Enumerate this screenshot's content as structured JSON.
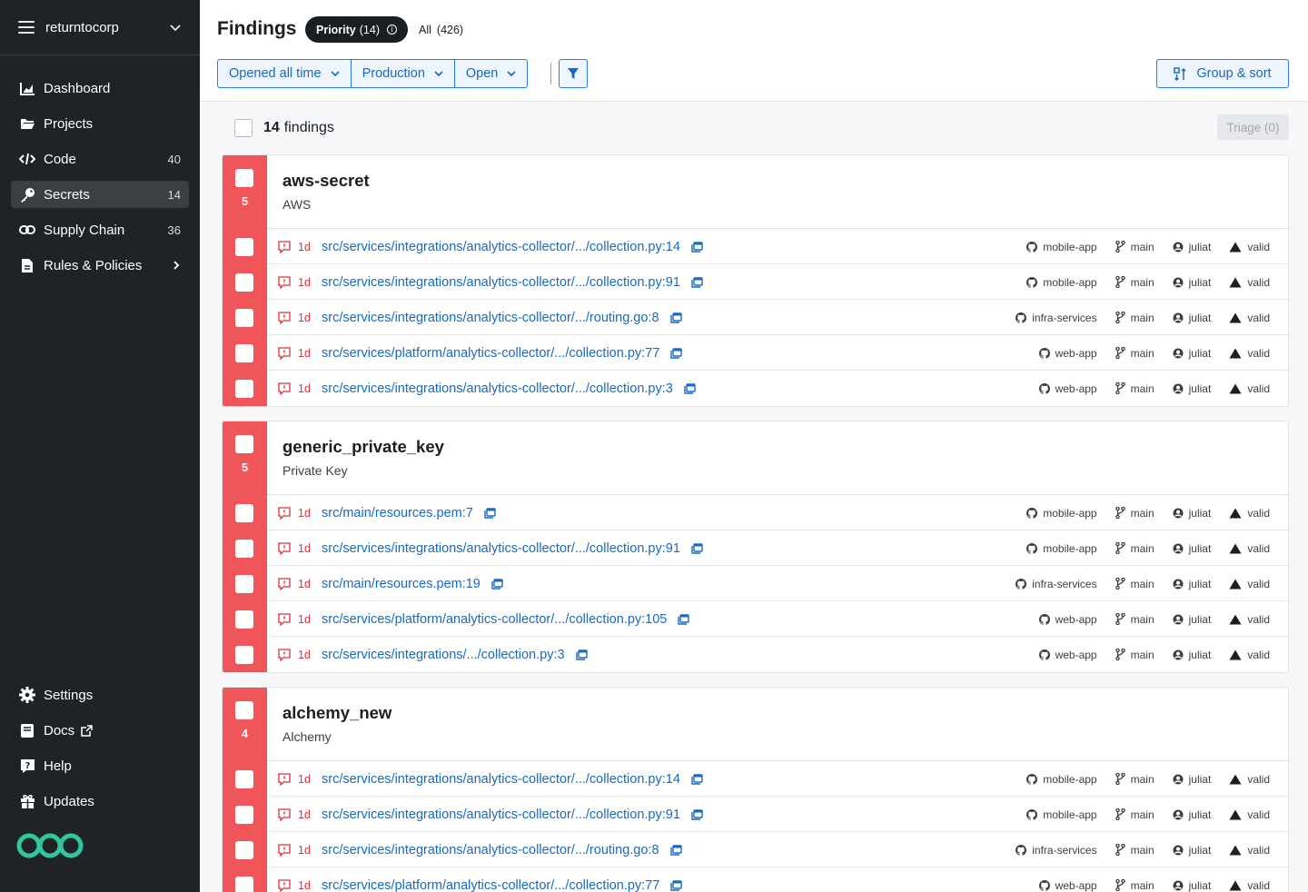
{
  "sidebar": {
    "org": "returntocorp",
    "items": [
      {
        "label": "Dashboard",
        "count": "",
        "icon": "chart-icon"
      },
      {
        "label": "Projects",
        "count": "",
        "icon": "folder-icon"
      },
      {
        "label": "Code",
        "count": "40",
        "icon": "code-icon"
      },
      {
        "label": "Secrets",
        "count": "14",
        "icon": "key-icon"
      },
      {
        "label": "Supply Chain",
        "count": "36",
        "icon": "link-icon"
      },
      {
        "label": "Rules & Policies",
        "count": "",
        "icon": "rules-icon"
      }
    ],
    "bottom": [
      {
        "label": "Settings"
      },
      {
        "label": "Docs"
      },
      {
        "label": "Help"
      },
      {
        "label": "Updates"
      }
    ]
  },
  "header": {
    "title": "Findings",
    "priority_label": "Priority",
    "priority_count": "(14)",
    "all_label": "All",
    "all_count": "(426)",
    "filters": [
      "Opened all time",
      "Production",
      "Open"
    ],
    "group_sort": "Group & sort"
  },
  "toolbar": {
    "count": "14",
    "count_label": "findings",
    "triage": "Triage (0)"
  },
  "colors": {
    "accent": "#2c7be5",
    "critical": "#f0555a",
    "sidebar": "#1f2326"
  },
  "groups": [
    {
      "name": "aws-secret",
      "sub": "AWS",
      "count": "5",
      "rows": [
        {
          "age": "1d",
          "path": "src/services/integrations/analytics-collector/.../collection.py:14",
          "repo": "mobile-app",
          "branch": "main",
          "user": "juliat",
          "status": "valid"
        },
        {
          "age": "1d",
          "path": "src/services/integrations/analytics-collector/.../collection.py:91",
          "repo": "mobile-app",
          "branch": "main",
          "user": "juliat",
          "status": "valid"
        },
        {
          "age": "1d",
          "path": "src/services/integrations/analytics-collector/.../routing.go:8",
          "repo": "infra-services",
          "branch": "main",
          "user": "juliat",
          "status": "valid"
        },
        {
          "age": "1d",
          "path": "src/services/platform/analytics-collector/.../collection.py:77",
          "repo": "web-app",
          "branch": "main",
          "user": "juliat",
          "status": "valid"
        },
        {
          "age": "1d",
          "path": "src/services/integrations/analytics-collector/.../collection.py:3",
          "repo": "web-app",
          "branch": "main",
          "user": "juliat",
          "status": "valid"
        }
      ]
    },
    {
      "name": "generic_private_key",
      "sub": "Private Key",
      "count": "5",
      "rows": [
        {
          "age": "1d",
          "path": "src/main/resources.pem:7",
          "repo": "mobile-app",
          "branch": "main",
          "user": "juliat",
          "status": "valid"
        },
        {
          "age": "1d",
          "path": "src/services/integrations/analytics-collector/.../collection.py:91",
          "repo": "mobile-app",
          "branch": "main",
          "user": "juliat",
          "status": "valid"
        },
        {
          "age": "1d",
          "path": "src/main/resources.pem:19",
          "repo": "infra-services",
          "branch": "main",
          "user": "juliat",
          "status": "valid"
        },
        {
          "age": "1d",
          "path": "src/services/platform/analytics-collector/.../collection.py:105",
          "repo": "web-app",
          "branch": "main",
          "user": "juliat",
          "status": "valid"
        },
        {
          "age": "1d",
          "path": "src/services/integrations/.../collection.py:3",
          "repo": "web-app",
          "branch": "main",
          "user": "juliat",
          "status": "valid"
        }
      ]
    },
    {
      "name": "alchemy_new",
      "sub": "Alchemy",
      "count": "4",
      "rows": [
        {
          "age": "1d",
          "path": "src/services/integrations/analytics-collector/.../collection.py:14",
          "repo": "mobile-app",
          "branch": "main",
          "user": "juliat",
          "status": "valid"
        },
        {
          "age": "1d",
          "path": "src/services/integrations/analytics-collector/.../collection.py:91",
          "repo": "mobile-app",
          "branch": "main",
          "user": "juliat",
          "status": "valid"
        },
        {
          "age": "1d",
          "path": "src/services/integrations/analytics-collector/.../routing.go:8",
          "repo": "infra-services",
          "branch": "main",
          "user": "juliat",
          "status": "valid"
        },
        {
          "age": "1d",
          "path": "src/services/platform/analytics-collector/.../collection.py:77",
          "repo": "web-app",
          "branch": "main",
          "user": "juliat",
          "status": "valid"
        }
      ]
    }
  ]
}
